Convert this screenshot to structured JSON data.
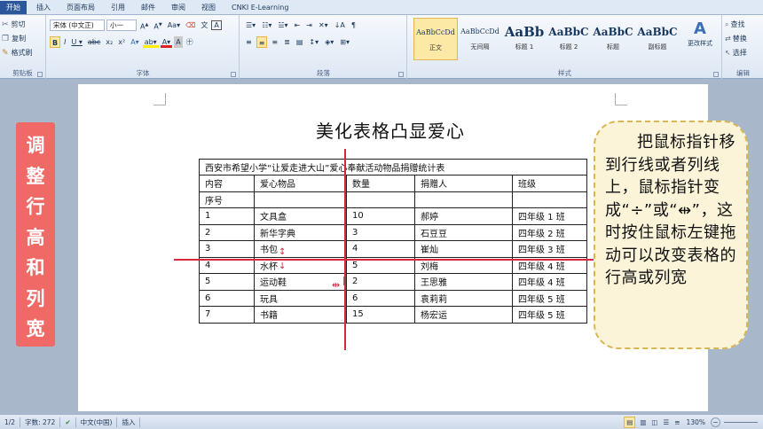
{
  "ribbon": {
    "tabs": [
      "开始",
      "插入",
      "页面布局",
      "引用",
      "邮件",
      "审阅",
      "视图",
      "CNKI E-Learning"
    ],
    "clipboard": {
      "cut": "剪切",
      "copy": "复制",
      "format_painter": "格式刷",
      "label": "剪贴板"
    },
    "font": {
      "name": "宋体 (中文正)",
      "size": "小一",
      "label": "字体"
    },
    "paragraph": {
      "label": "段落"
    },
    "styles": {
      "items": [
        {
          "preview": "AaBbCcDd",
          "name": "正文"
        },
        {
          "preview": "AaBbCcDd",
          "name": "无间隔"
        },
        {
          "preview": "AaBb",
          "name": "标题 1"
        },
        {
          "preview": "AaBbC",
          "name": "标题 2"
        },
        {
          "preview": "AaBbC",
          "name": "标题"
        },
        {
          "preview": "AaBbC",
          "name": "副标题"
        }
      ],
      "change_styles": "更改样式",
      "label": "样式"
    },
    "editing": {
      "find": "查找",
      "replace": "替换",
      "select": "选择",
      "label": "编辑"
    }
  },
  "document": {
    "title": "美化表格凸显爱心",
    "table": {
      "caption": "西安市希望小学“让爱走进大山”爱心奉献活动物品捐赠统计表",
      "headers": [
        "内容",
        "爱心物品",
        "数量",
        "捐赠人",
        "班级"
      ],
      "subheader": "序号",
      "rows": [
        [
          "1",
          "文具盒",
          "10",
          "郝婷",
          "四年级 1 班"
        ],
        [
          "2",
          "新华字典",
          "3",
          "石豆豆",
          "四年级 2 班"
        ],
        [
          "3",
          "书包",
          "4",
          "崔灿",
          "四年级 3 班"
        ],
        [
          "4",
          "水杯",
          "5",
          "刘梅",
          "四年级 4 班"
        ],
        [
          "5",
          "运动鞋",
          "2",
          "王思雅",
          "四年级 4 班"
        ],
        [
          "6",
          "玩具",
          "6",
          "袁莉莉",
          "四年级 5 班"
        ],
        [
          "7",
          "书籍",
          "15",
          "杨宏运",
          "四年级 5 班"
        ]
      ]
    }
  },
  "overlay": {
    "banner": "调整行高和列宽",
    "callout": "把鼠标指针移到行线或者列线上，鼠标指针变成“÷”或“⇹”，这时按住鼠标左键拖动可以改变表格的行高或列宽"
  },
  "statusbar": {
    "page": "1/2",
    "words": "字数: 272",
    "language": "中文(中国)",
    "mode": "插入",
    "zoom": "130%"
  },
  "colors": {
    "banner": "#ef6a67",
    "callout_bg": "#fbf4d9",
    "guide_line": "#d7263d",
    "file_tab": "#2b579a"
  }
}
